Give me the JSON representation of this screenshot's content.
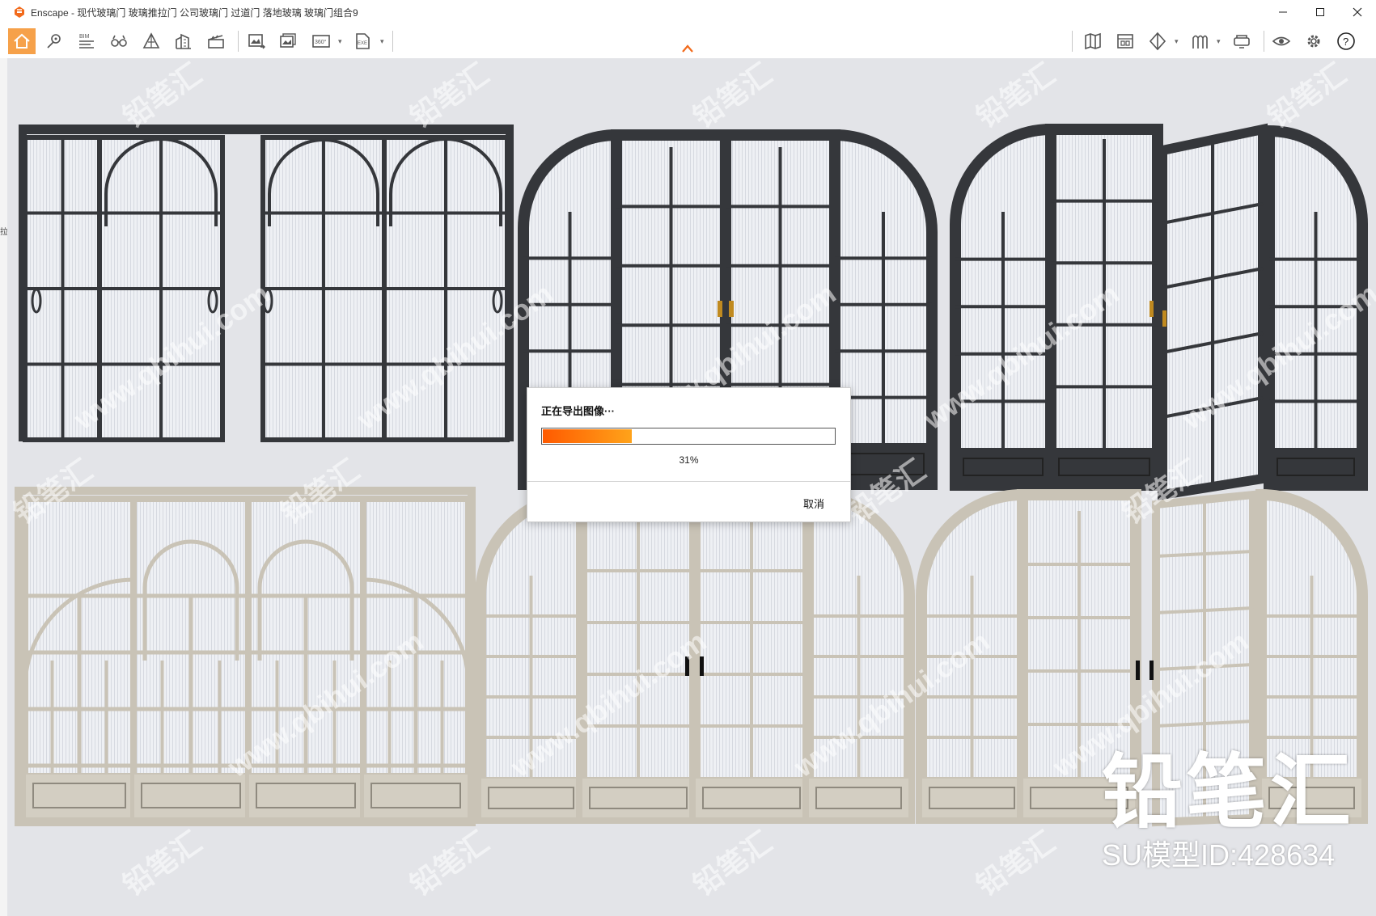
{
  "window": {
    "title": "Enscape - 现代玻璃门 玻璃推拉门 公司玻璃门 过道门 落地玻璃 玻璃门组合9"
  },
  "window_controls": [
    "minimize-icon",
    "maximize-icon",
    "close-icon"
  ],
  "toolbar": {
    "left_tools": [
      "home-icon",
      "location-pin-icon",
      "bim-icon",
      "binoculars-icon",
      "perspective-icon",
      "building-icon",
      "clapperboard-icon",
      "render-image-icon",
      "batch-render-icon",
      "panorama-360-icon",
      "export-exe-icon"
    ],
    "bim_label": "BIM",
    "pano_label": "360°",
    "exe_label": "EXE",
    "right_tools": [
      "map-icon",
      "asset-library-icon",
      "cube-icon",
      "material-icon",
      "vr-headset-icon",
      "visual-settings-icon",
      "settings-gear-icon",
      "help-icon"
    ]
  },
  "left_edge_text": "拉",
  "dialog": {
    "title": "正在导出图像···",
    "progress": 0.31,
    "percent_text": "31%",
    "cancel_label": "取消",
    "accent_start": "#ff5a00",
    "accent_end": "#ffa31a"
  },
  "watermark": {
    "brand": "铅笔汇",
    "model_id": "SU模型ID:428634",
    "tile_cn": "铅笔汇",
    "tile_url": "www.qbihui.com"
  },
  "colors": {
    "active_tool": "#f6a14a",
    "viewport_bg": "#e3e4e8",
    "dark_frame": "#35373b",
    "light_frame": "#c9c3b6"
  }
}
